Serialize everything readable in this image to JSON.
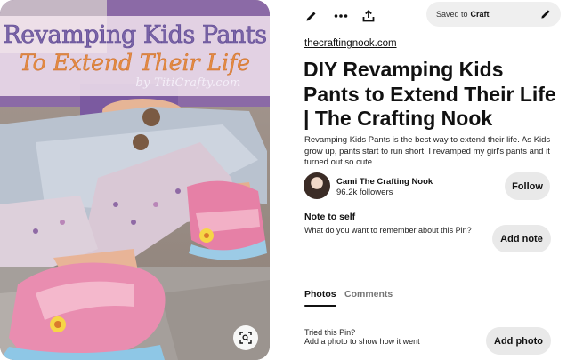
{
  "image": {
    "banner_line1": "Revamping Kids Pants",
    "banner_line2": "To Extend Their Life",
    "banner_credit": "by TitiCrafty.com"
  },
  "toolbar": {
    "icons": [
      "pencil-icon",
      "more-icon",
      "share-icon"
    ],
    "saved_prefix": "Saved to",
    "saved_board": "Craft"
  },
  "pin": {
    "source": "thecraftingnook.com",
    "title": "DIY Revamping Kids Pants to Extend Their Life | The Crafting Nook",
    "description": "Revamping Kids Pants is the best way to extend their life. As Kids grow up, pants start to run short. I revamped my girl's pants and it turned out so cute."
  },
  "author": {
    "name": "Cami The Crafting Nook",
    "followers": "96.2k followers",
    "follow_label": "Follow"
  },
  "note": {
    "heading": "Note to self",
    "prompt": "What do you want to remember about this Pin?",
    "button": "Add note"
  },
  "tabs": [
    {
      "label": "Photos",
      "active": true
    },
    {
      "label": "Comments",
      "active": false
    }
  ],
  "tried": {
    "title": "Tried this Pin?",
    "subtitle": "Add a photo to show how it went",
    "button": "Add photo"
  }
}
